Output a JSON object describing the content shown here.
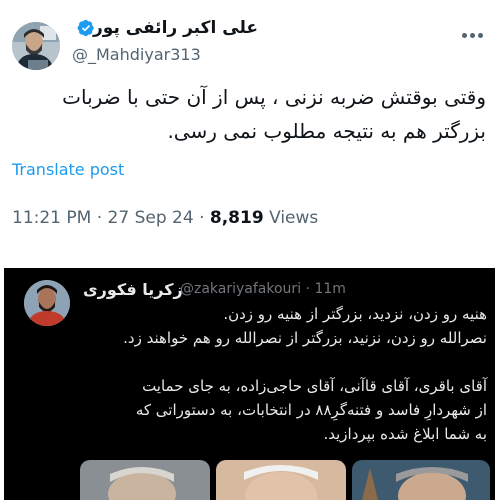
{
  "tweet": {
    "author_name": "علی اکبر رائفی پور",
    "handle": "@_Mahdiyar313",
    "verified_icon": "verified-badge-icon",
    "text": "وقتی بوقتش ضربه نزنی ، پس از آن حتی با ضربات\nبزرگتر هم به نتیجه مطلوب نمی رسی.",
    "translate_label": "Translate post",
    "time": "11:21 PM",
    "date": "27 Sep 24",
    "separator": "·",
    "views_count": "8,819",
    "views_label": "Views"
  },
  "quoted": {
    "author_name": "زکریا فکوری",
    "handle": "@zakariyafakouri",
    "time": "11m",
    "separator": "·",
    "text": "هنیه رو زدن، نزدید، بزرگتر از هنیه رو زدن.\nنصرالله رو زدن، نزنید، بزرگتر از نصرالله رو هم خواهند زد.\n\nآقای باقری، آقای قاآنی، آقای حاجی‌زاده، به جای حمایت\nاز شهردارِ فاسد و فتنه‌گرِ۸۸ در انتخابات، به دستوراتی که\nبه شما ابلاغ شده بپردازید."
  },
  "colors": {
    "accent": "#1d9bf0",
    "secondary_text": "#536471",
    "dark_bg": "#000000"
  }
}
